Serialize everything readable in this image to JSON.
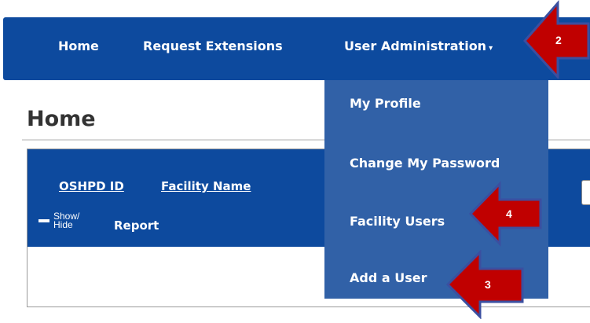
{
  "nav": {
    "home": "Home",
    "request_extensions": "Request Extensions",
    "user_administration": "User Administration",
    "caret": "▾"
  },
  "page": {
    "title": "Home"
  },
  "panel": {
    "oshpd_id": "OSHPD ID",
    "facility_name": "Facility Name",
    "show_hide": "Show/ Hide",
    "report": "Report",
    "select_caret": "▾"
  },
  "dropdown": {
    "items": [
      "My Profile",
      "Change My Password",
      "Facility Users",
      "Add a User"
    ]
  },
  "callouts": {
    "two": "2",
    "three": "3",
    "four": "4"
  },
  "colors": {
    "nav_bg": "#0d4a9e",
    "dropdown_bg": "#3161a7",
    "callout_fill": "#c00000",
    "callout_border": "#3b4fa0"
  }
}
